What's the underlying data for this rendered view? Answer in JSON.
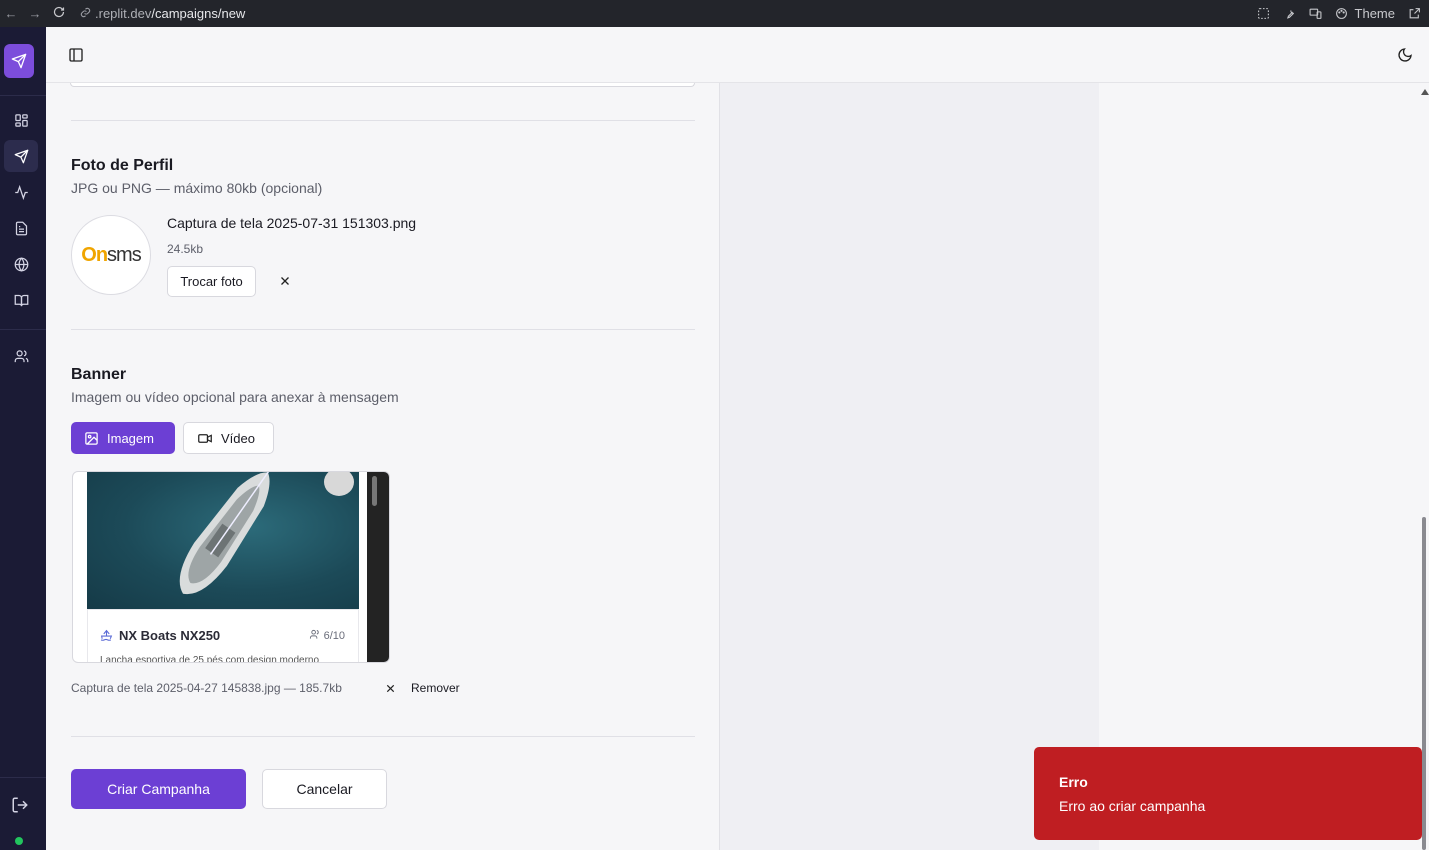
{
  "browser": {
    "url_domain": ".replit.dev",
    "url_path": "/campaigns/new",
    "theme_label": "Theme"
  },
  "profile_photo": {
    "title": "Foto de Perfil",
    "subtitle": "JPG ou PNG — máximo 80kb (opcional)",
    "file_name": "Captura de tela 2025-07-31 151303.png",
    "file_size": "24.5kb",
    "change_label": "Trocar foto",
    "logo_text_o": "On",
    "logo_text_rest": "sms"
  },
  "banner": {
    "title": "Banner",
    "subtitle": "Imagem ou vídeo opcional para anexar à mensagem",
    "tabs": [
      {
        "label": "Imagem",
        "active": true
      },
      {
        "label": "Vídeo",
        "active": false
      }
    ],
    "preview": {
      "card_title": "NX Boats NX250",
      "capacity": "6/10",
      "description": "Lancha esportiva de 25 pés com design moderno"
    },
    "file_info": "Captura de tela 2025-04-27 145838.jpg — 185.7kb",
    "remove_label": "Remover"
  },
  "actions": {
    "submit_label": "Criar Campanha",
    "cancel_label": "Cancelar"
  },
  "toast": {
    "title": "Erro",
    "message": "Erro ao criar campanha"
  },
  "colors": {
    "primary": "#6c3fd4",
    "sidebar": "#1b1b35",
    "toast_error": "#bf1e22",
    "online": "#22c55e"
  }
}
